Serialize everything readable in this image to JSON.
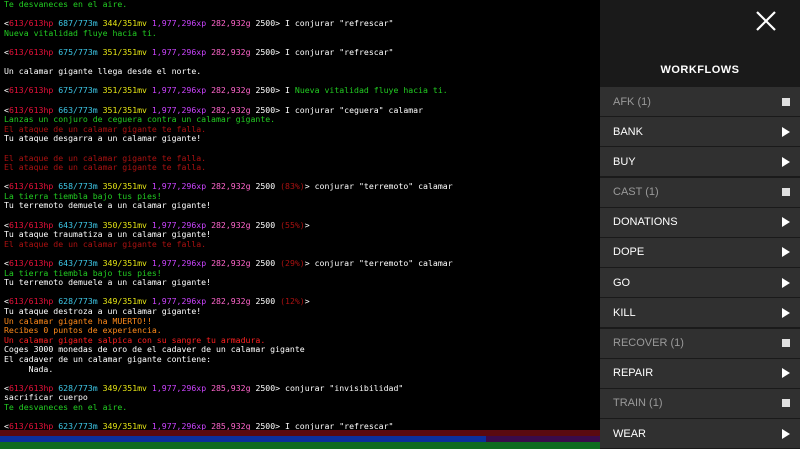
{
  "colors": {
    "hp": "#e8113a",
    "mana": "#3ec8e8",
    "mv": "#e5e515",
    "xp": "#cc44ff",
    "gold": "#ff66cc",
    "text": "#ffffff",
    "green": "#22cc22",
    "red": "#ff2020",
    "dim_red": "#aa1111",
    "orange": "#ff8a1a",
    "salmon": "#ff6f6f"
  },
  "terminal": {
    "lines": [
      [
        {
          "t": "Te desvaneces en el aire.",
          "c": "green"
        }
      ],
      [
        {
          "t": "",
          "c": "text"
        }
      ],
      [
        {
          "t": "<",
          "c": "text"
        },
        {
          "t": "613/613hp",
          "c": "hp"
        },
        {
          "t": " 687/773m",
          "c": "mana"
        },
        {
          "t": " 344/351mv",
          "c": "mv"
        },
        {
          "t": " 1,977,296xp",
          "c": "xp"
        },
        {
          "t": " 282,932g",
          "c": "gold"
        },
        {
          "t": " 2500> I conjurar \"refrescar\"",
          "c": "text"
        }
      ],
      [
        {
          "t": "Nueva vitalidad fluye hacia ti.",
          "c": "green"
        }
      ],
      [
        {
          "t": "",
          "c": "text"
        }
      ],
      [
        {
          "t": "<",
          "c": "text"
        },
        {
          "t": "613/613hp",
          "c": "hp"
        },
        {
          "t": " 675/773m",
          "c": "mana"
        },
        {
          "t": " 351/351mv",
          "c": "mv"
        },
        {
          "t": " 1,977,296xp",
          "c": "xp"
        },
        {
          "t": " 282,932g",
          "c": "gold"
        },
        {
          "t": " 2500> I conjurar \"refrescar\"",
          "c": "text"
        }
      ],
      [
        {
          "t": "",
          "c": "text"
        }
      ],
      [
        {
          "t": "Un calamar gigante llega desde el norte.",
          "c": "text"
        }
      ],
      [
        {
          "t": "",
          "c": "text"
        }
      ],
      [
        {
          "t": "<",
          "c": "text"
        },
        {
          "t": "613/613hp",
          "c": "hp"
        },
        {
          "t": " 675/773m",
          "c": "mana"
        },
        {
          "t": " 351/351mv",
          "c": "mv"
        },
        {
          "t": " 1,977,296xp",
          "c": "xp"
        },
        {
          "t": " 282,932g",
          "c": "gold"
        },
        {
          "t": " 2500> I ",
          "c": "text"
        },
        {
          "t": "Nueva vitalidad fluye hacia ti.",
          "c": "green"
        }
      ],
      [
        {
          "t": "",
          "c": "text"
        }
      ],
      [
        {
          "t": "<",
          "c": "text"
        },
        {
          "t": "613/613hp",
          "c": "hp"
        },
        {
          "t": " 663/773m",
          "c": "mana"
        },
        {
          "t": " 351/351mv",
          "c": "mv"
        },
        {
          "t": " 1,977,296xp",
          "c": "xp"
        },
        {
          "t": " 282,932g",
          "c": "gold"
        },
        {
          "t": " 2500> I conjurar \"ceguera\" calamar",
          "c": "text"
        }
      ],
      [
        {
          "t": "Lanzas un conjuro de ceguera contra un calamar gigante.",
          "c": "green"
        }
      ],
      [
        {
          "t": "El ataque de un calamar gigante te falla.",
          "c": "dim_red"
        }
      ],
      [
        {
          "t": "Tu ataque desgarra a un calamar gigante!",
          "c": "text"
        }
      ],
      [
        {
          "t": "",
          "c": "text"
        }
      ],
      [
        {
          "t": "El ataque de un calamar gigante te falla.",
          "c": "dim_red"
        }
      ],
      [
        {
          "t": "El ataque de un calamar gigante te falla.",
          "c": "dim_red"
        }
      ],
      [
        {
          "t": "",
          "c": "text"
        }
      ],
      [
        {
          "t": "<",
          "c": "text"
        },
        {
          "t": "613/613hp",
          "c": "hp"
        },
        {
          "t": " 658/773m",
          "c": "mana"
        },
        {
          "t": " 350/351mv",
          "c": "mv"
        },
        {
          "t": " 1,977,296xp",
          "c": "xp"
        },
        {
          "t": " 282,932g",
          "c": "gold"
        },
        {
          "t": " 2500 ",
          "c": "text"
        },
        {
          "t": "(83%)",
          "c": "dim_red"
        },
        {
          "t": "> conjurar \"terremoto\" calamar",
          "c": "text"
        }
      ],
      [
        {
          "t": "La tierra tiembla bajo tus pies!",
          "c": "green"
        }
      ],
      [
        {
          "t": "Tu terremoto demuele a un calamar gigante!",
          "c": "text"
        }
      ],
      [
        {
          "t": "",
          "c": "text"
        }
      ],
      [
        {
          "t": "<",
          "c": "text"
        },
        {
          "t": "613/613hp",
          "c": "hp"
        },
        {
          "t": " 643/773m",
          "c": "mana"
        },
        {
          "t": " 350/351mv",
          "c": "mv"
        },
        {
          "t": " 1,977,296xp",
          "c": "xp"
        },
        {
          "t": " 282,932g",
          "c": "gold"
        },
        {
          "t": " 2500 ",
          "c": "text"
        },
        {
          "t": "(55%)",
          "c": "dim_red"
        },
        {
          "t": ">",
          "c": "text"
        }
      ],
      [
        {
          "t": "Tu ataque traumatiza a un calamar gigante!",
          "c": "text"
        }
      ],
      [
        {
          "t": "El ataque de un calamar gigante te falla.",
          "c": "dim_red"
        }
      ],
      [
        {
          "t": "",
          "c": "text"
        }
      ],
      [
        {
          "t": "<",
          "c": "text"
        },
        {
          "t": "613/613hp",
          "c": "hp"
        },
        {
          "t": " 643/773m",
          "c": "mana"
        },
        {
          "t": " 349/351mv",
          "c": "mv"
        },
        {
          "t": " 1,977,296xp",
          "c": "xp"
        },
        {
          "t": " 282,932g",
          "c": "gold"
        },
        {
          "t": " 2500 ",
          "c": "text"
        },
        {
          "t": "(29%)",
          "c": "dim_red"
        },
        {
          "t": "> conjurar \"terremoto\" calamar",
          "c": "text"
        }
      ],
      [
        {
          "t": "La tierra tiembla bajo tus pies!",
          "c": "green"
        }
      ],
      [
        {
          "t": "Tu terremoto demuele a un calamar gigante!",
          "c": "text"
        }
      ],
      [
        {
          "t": "",
          "c": "text"
        }
      ],
      [
        {
          "t": "<",
          "c": "text"
        },
        {
          "t": "613/613hp",
          "c": "hp"
        },
        {
          "t": " 628/773m",
          "c": "mana"
        },
        {
          "t": " 349/351mv",
          "c": "mv"
        },
        {
          "t": " 1,977,296xp",
          "c": "xp"
        },
        {
          "t": " 282,932g",
          "c": "gold"
        },
        {
          "t": " 2500 ",
          "c": "text"
        },
        {
          "t": "(12%)",
          "c": "dim_red"
        },
        {
          "t": ">",
          "c": "text"
        }
      ],
      [
        {
          "t": "Tu ataque destroza a un calamar gigante!",
          "c": "text"
        }
      ],
      [
        {
          "t": "Un calamar gigante ha MUERTO!!",
          "c": "orange"
        }
      ],
      [
        {
          "t": "Recibes 0 puntos de experiencia.",
          "c": "orange"
        }
      ],
      [
        {
          "t": "Un calamar gigante salpica con su sangre tu armadura.",
          "c": "red"
        }
      ],
      [
        {
          "t": "Coges 3000 monedas de oro de el cadaver de un calamar gigante",
          "c": "text"
        }
      ],
      [
        {
          "t": "El cadaver de un calamar gigante contiene:",
          "c": "text"
        }
      ],
      [
        {
          "t": "     Nada.",
          "c": "text"
        }
      ],
      [
        {
          "t": "",
          "c": "text"
        }
      ],
      [
        {
          "t": "<",
          "c": "text"
        },
        {
          "t": "613/613hp",
          "c": "hp"
        },
        {
          "t": " 628/773m",
          "c": "mana"
        },
        {
          "t": " 349/351mv",
          "c": "mv"
        },
        {
          "t": " 1,977,296xp",
          "c": "xp"
        },
        {
          "t": " 285,932g",
          "c": "gold"
        },
        {
          "t": " 2500> conjurar \"invisibilidad\"",
          "c": "text"
        }
      ],
      [
        {
          "t": "sacrificar cuerpo",
          "c": "text"
        }
      ],
      [
        {
          "t": "Te desvaneces en el aire.",
          "c": "green"
        }
      ],
      [
        {
          "t": "",
          "c": "text"
        }
      ],
      [
        {
          "t": "<",
          "c": "text"
        },
        {
          "t": "613/613hp",
          "c": "hp"
        },
        {
          "t": " 623/773m",
          "c": "mana"
        },
        {
          "t": " 349/351mv",
          "c": "mv"
        },
        {
          "t": " 1,977,296xp",
          "c": "xp"
        },
        {
          "t": " 285,932g",
          "c": "gold"
        },
        {
          "t": " 2500> I conjurar \"refrescar\"",
          "c": "text"
        }
      ]
    ]
  },
  "status_bars": {
    "hp_fraction": 1.0,
    "mana_fraction": 0.81,
    "mv_fraction": 1.0
  },
  "panel": {
    "close_icon": "close-icon",
    "title": "WORKFLOWS",
    "items": [
      {
        "label": "AFK (1)",
        "icon": "stop",
        "disabled": true
      },
      {
        "label": "BANK",
        "icon": "play",
        "disabled": false
      },
      {
        "label": "BUY",
        "icon": "play",
        "disabled": false
      },
      {
        "label": "CAST (1)",
        "icon": "stop",
        "disabled": true
      },
      {
        "label": "DONATIONS",
        "icon": "play",
        "disabled": false
      },
      {
        "label": "DOPE",
        "icon": "play",
        "disabled": false
      },
      {
        "label": "GO",
        "icon": "play",
        "disabled": false
      },
      {
        "label": "KILL",
        "icon": "play",
        "disabled": false
      },
      {
        "label": "RECOVER (1)",
        "icon": "stop",
        "disabled": true
      },
      {
        "label": "REPAIR",
        "icon": "play",
        "disabled": false
      },
      {
        "label": "TRAIN (1)",
        "icon": "stop",
        "disabled": true
      },
      {
        "label": "WEAR",
        "icon": "play",
        "disabled": false
      }
    ]
  }
}
